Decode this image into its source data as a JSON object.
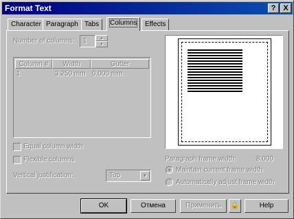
{
  "window": {
    "title": "Format Text",
    "help_glyph": "?",
    "close_glyph": "X"
  },
  "tabs": [
    {
      "label": "Character",
      "active": false
    },
    {
      "label": "Paragraph",
      "active": false
    },
    {
      "label": "Tabs",
      "active": false
    },
    {
      "label": "Columns",
      "active": true
    },
    {
      "label": "Effects",
      "active": false
    }
  ],
  "columns": {
    "number_label": "Number of columns:",
    "number_value": "1",
    "table_headers": [
      "Column #",
      "Width",
      "Gutter"
    ],
    "rows": [
      {
        "column": "1",
        "width": "3.250 mm",
        "gutter": "0.000 mm"
      }
    ],
    "equal_width_label": "Equal column width",
    "flexible_label": "Flexible columns",
    "vertical_justification_label": "Vertical justification:",
    "vertical_justification_value": "Top"
  },
  "frame": {
    "width_label": "Paragraph frame width:",
    "width_value": "8.000",
    "maintain_label": "Maintain current frame width",
    "auto_adjust_label": "Automatically adjust frame width"
  },
  "buttons": {
    "ok": "OK",
    "cancel": "Отмена",
    "apply": "Применить",
    "help": "Help",
    "lock_glyph": "🔒"
  },
  "glyphs": {
    "spin_up": "▲",
    "spin_down": "▼",
    "select_arrow": "▼"
  }
}
